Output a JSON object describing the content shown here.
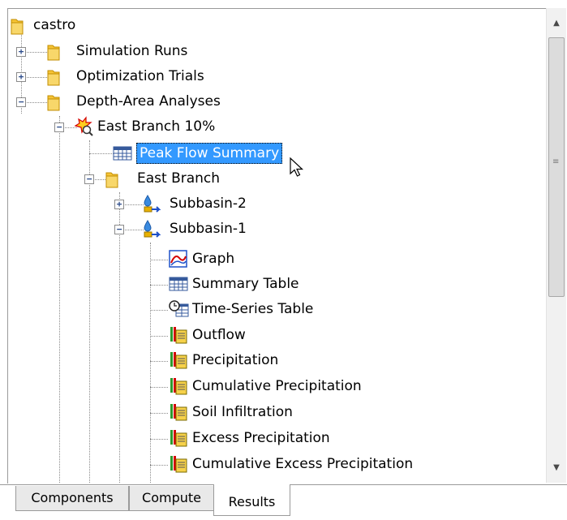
{
  "tree": {
    "root": "castro",
    "simulation_runs": "Simulation Runs",
    "optimization_trials": "Optimization Trials",
    "depth_area_analyses": "Depth-Area Analyses",
    "east_branch_10": "East Branch 10%",
    "peak_flow_summary": "Peak Flow Summary",
    "east_branch": "East Branch",
    "subbasin_2": "Subbasin-2",
    "subbasin_1": "Subbasin-1",
    "graph": "Graph",
    "summary_table": "Summary Table",
    "time_series_table": "Time-Series Table",
    "outflow": "Outflow",
    "precipitation": "Precipitation",
    "cumulative_precipitation": "Cumulative Precipitation",
    "soil_infiltration": "Soil Infiltration",
    "excess_precipitation": "Excess Precipitation",
    "cumulative_excess_precipitation": "Cumulative Excess Precipitation"
  },
  "tabs": {
    "components": "Components",
    "compute": "Compute",
    "results": "Results",
    "active": "Results"
  },
  "colors": {
    "selection": "#3399ff",
    "folder": "#e8b100",
    "graph_red": "#d40000",
    "graph_blue": "#1e50c8"
  },
  "icons": {
    "folder": "folder-icon",
    "analysis": "depth-area-analysis-icon",
    "table": "table-icon",
    "subbasin": "subbasin-icon",
    "graph": "graph-icon",
    "time_series": "time-series-table-icon",
    "result": "result-data-icon",
    "cursor": "mouse-cursor-icon"
  }
}
